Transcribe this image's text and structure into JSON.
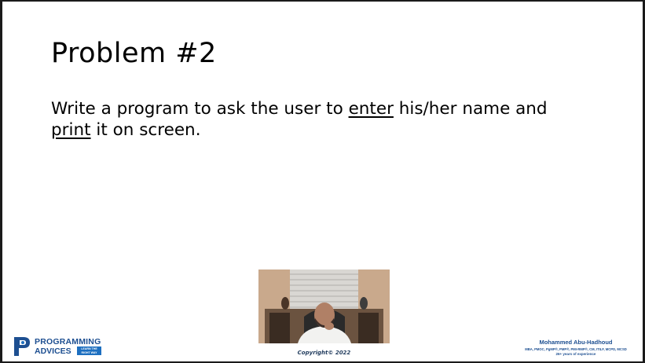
{
  "slide": {
    "title": "Problem #2",
    "body": {
      "part1": "Write a program to ask the user to ",
      "underline1": "enter",
      "part2": " his/her name and ",
      "underline2": "print",
      "part3": " it on screen."
    }
  },
  "footer": {
    "logo_line1": "PROGRAMMING",
    "logo_line2": "ADVICES",
    "logo_tagline_1": "LEARN THE",
    "logo_tagline_2": "RIGHT WAY",
    "copyright": "Copyright© 2022",
    "presenter_name": "Mohammed Abu-Hadhoud",
    "presenter_credentials": "MBA, PMOC, PgMP®, PMP®, PMI-RMP®, CM, ITILF, MCPD, MCSD",
    "presenter_experience": "26+ years of experience"
  },
  "colors": {
    "brand_blue": "#1d4f91",
    "tag_blue": "#1d6fc0"
  },
  "icons": {
    "logo": "programming-advices-logo-icon"
  }
}
